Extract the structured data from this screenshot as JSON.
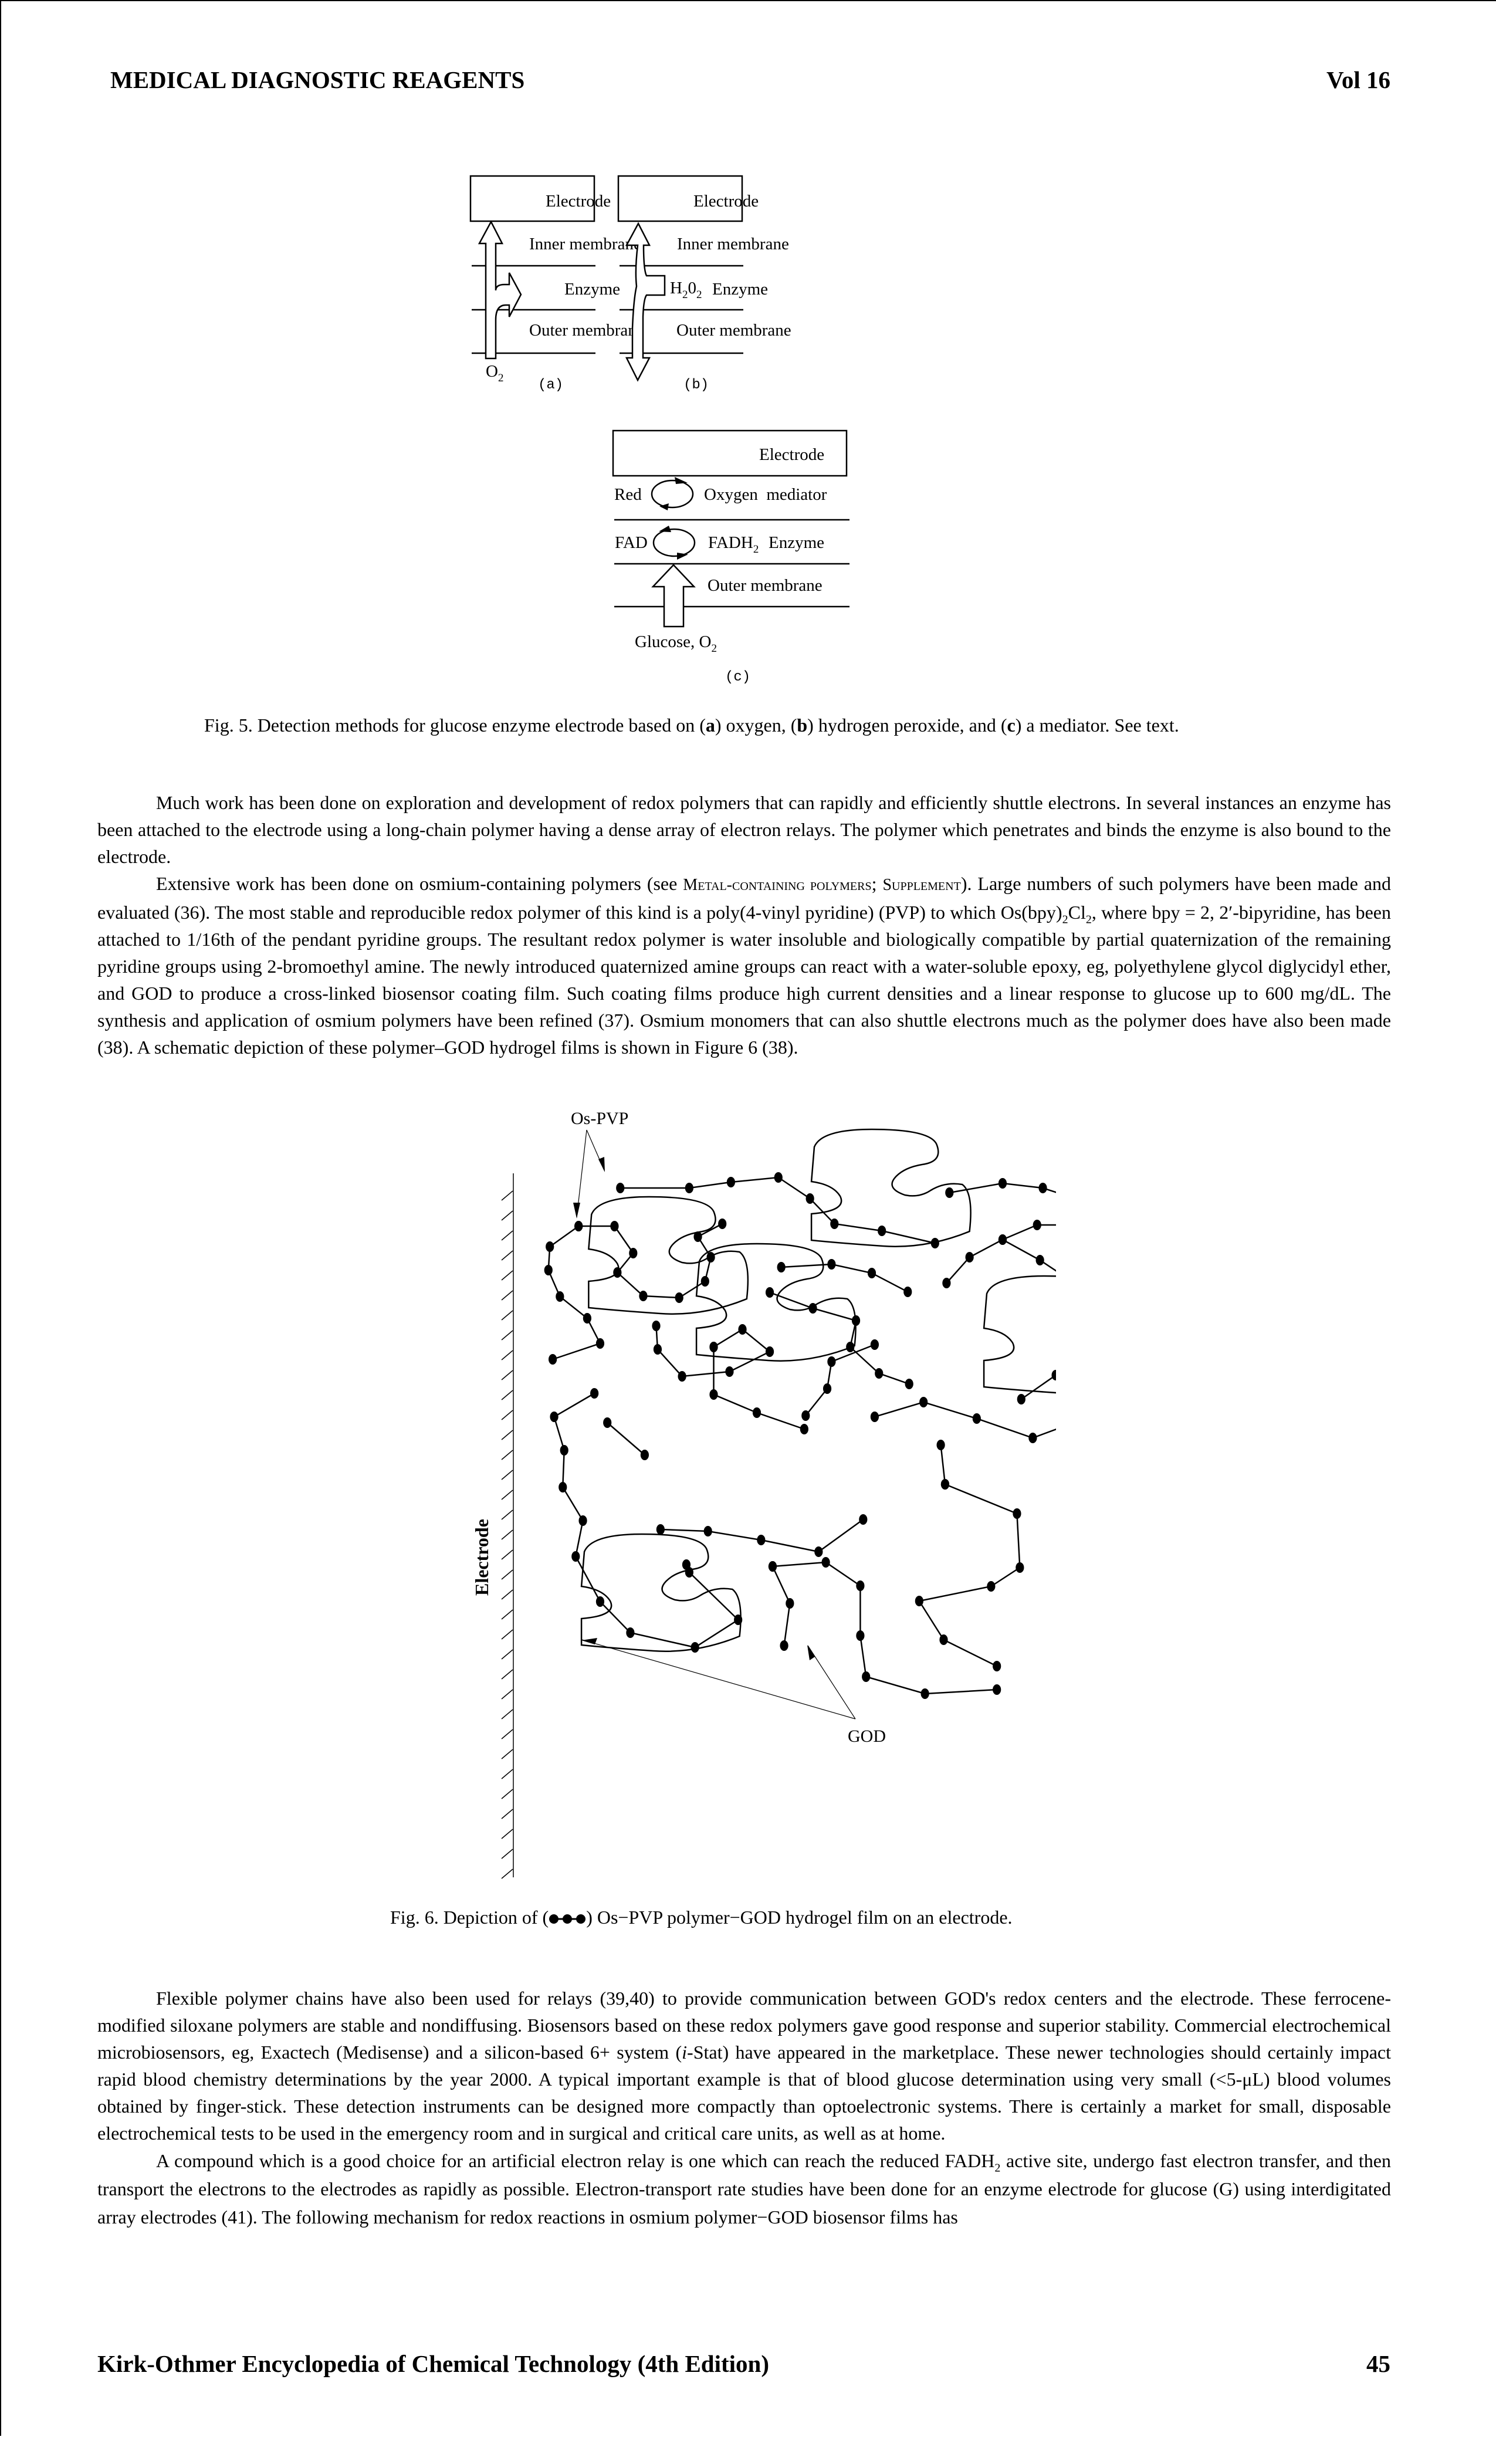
{
  "header": {
    "section_title": "MEDICAL DIAGNOSTIC REAGENTS",
    "volume": "Vol 16"
  },
  "figure5": {
    "panel_a": {
      "electrode": "Electrode",
      "inner": "Inner membrane",
      "enzyme": "Enzyme",
      "outer": "Outer membrane",
      "input": "O",
      "input_sub": "2",
      "label": "(a)"
    },
    "panel_b": {
      "electrode": "Electrode",
      "inner": "Inner membrane",
      "enzyme": "Enzyme",
      "outer": "Outer membrane",
      "species": "H",
      "species_sub1": "2",
      "species_mid": "0",
      "species_sub2": "2",
      "label": "(b)"
    },
    "panel_c": {
      "electrode": "Electrode",
      "red": "Red",
      "oxygen_mediator": "Oxygen  mediator",
      "fad": "FAD",
      "fadh": "FADH",
      "fadh_sub": "2",
      "enzyme": "Enzyme",
      "outer": "Outer membrane",
      "input": "Glucose, O",
      "input_sub": "2",
      "label": "(c)"
    },
    "caption": {
      "prefix": "Fig. 5. Detection methods for glucose enzyme electrode based on (",
      "a": "a",
      "mid1": ") oxygen, (",
      "b": "b",
      "mid2": ") hydrogen peroxide, and (",
      "c": "c",
      "suffix": ") a mediator. See text."
    }
  },
  "body1": {
    "p1": "Much work has been done on exploration and development of redox polymers that can rapidly and efficiently shuttle electrons. In several instances an enzyme has been attached to the electrode using a long-chain polymer having a dense array of electron relays. The polymer which penetrates and binds the enzyme is also bound to the electrode.",
    "p2_a": "Extensive work has been done on osmium-containing polymers (see ",
    "p2_link1": "Metal-containing polymers",
    "p2_sep": "; ",
    "p2_link2": "Supplement",
    "p2_b": "). Large numbers of such polymers have been made and evaluated (36). The most stable and reproducible redox polymer of this kind is a poly(4-vinyl pyridine) (PVP) to which Os(bpy)",
    "p2_sub1": "2",
    "p2_c": "Cl",
    "p2_sub2": "2",
    "p2_d": ", where bpy = 2, 2′-bipyridine, has been attached to 1/16th of the pendant pyridine groups. The resultant redox polymer is water insoluble and biologically compatible by partial quaternization of the remaining pyridine groups using 2-bromoethyl amine. The newly introduced quaternized amine groups can react with a water-soluble epoxy, eg, polyethylene glycol diglycidyl ether, and GOD to produce a cross-linked biosensor coating film. Such coating films produce high current densities and a linear response to glucose up to 600 mg/dL. The synthesis and application of osmium polymers have been refined (37). Osmium monomers that can also shuttle electrons much as the polymer does have also been made (38). A schematic depiction of these polymer–GOD hydrogel films is shown in Figure 6 (38)."
  },
  "figure6": {
    "label_os_pvp": "Os-PVP",
    "label_god": "GOD",
    "label_electrode": "Electrode",
    "caption_prefix": "Fig. 6. Depiction of (",
    "caption_suffix": ") Os−PVP polymer−GOD hydrogel film on an electrode."
  },
  "body2": {
    "p3": "Flexible polymer chains have also been used for relays (39,40) to provide communication between GOD's redox centers and the electrode. These ferrocene-modified siloxane polymers are stable and nondiffusing. Biosensors based on these redox polymers gave good response and superior stability. Commercial electrochemical microbiosensors, eg, Exactech (Medisense) and a silicon-based 6+ system (",
    "p3_i": "i",
    "p3_b": "-Stat) have appeared in the marketplace. These newer technologies should certainly impact rapid blood chemistry determinations by the year 2000. A typical important example is that of blood glucose determination using very small (<5-μL) blood volumes obtained by finger-stick. These detection instruments can be designed more compactly than optoelectronic systems. There is certainly a market for small, disposable electrochemical tests to be used in the emergency room and in surgical and critical care units, as well as at home.",
    "p4_a": "A compound which is a good choice for an artificial electron relay is one which can reach the reduced FADH",
    "p4_sub": "2",
    "p4_b": " active site, undergo fast electron transfer, and then transport the electrons to the electrodes as rapidly as possible. Electron-transport rate studies have been done for an enzyme electrode for glucose (G) using interdigitated array electrodes (41). The following mechanism for redox reactions in osmium polymer−GOD biosensor films has"
  },
  "footer": {
    "book_title": "Kirk-Othmer Encyclopedia of Chemical Technology (4th Edition)",
    "page_number": "45"
  }
}
